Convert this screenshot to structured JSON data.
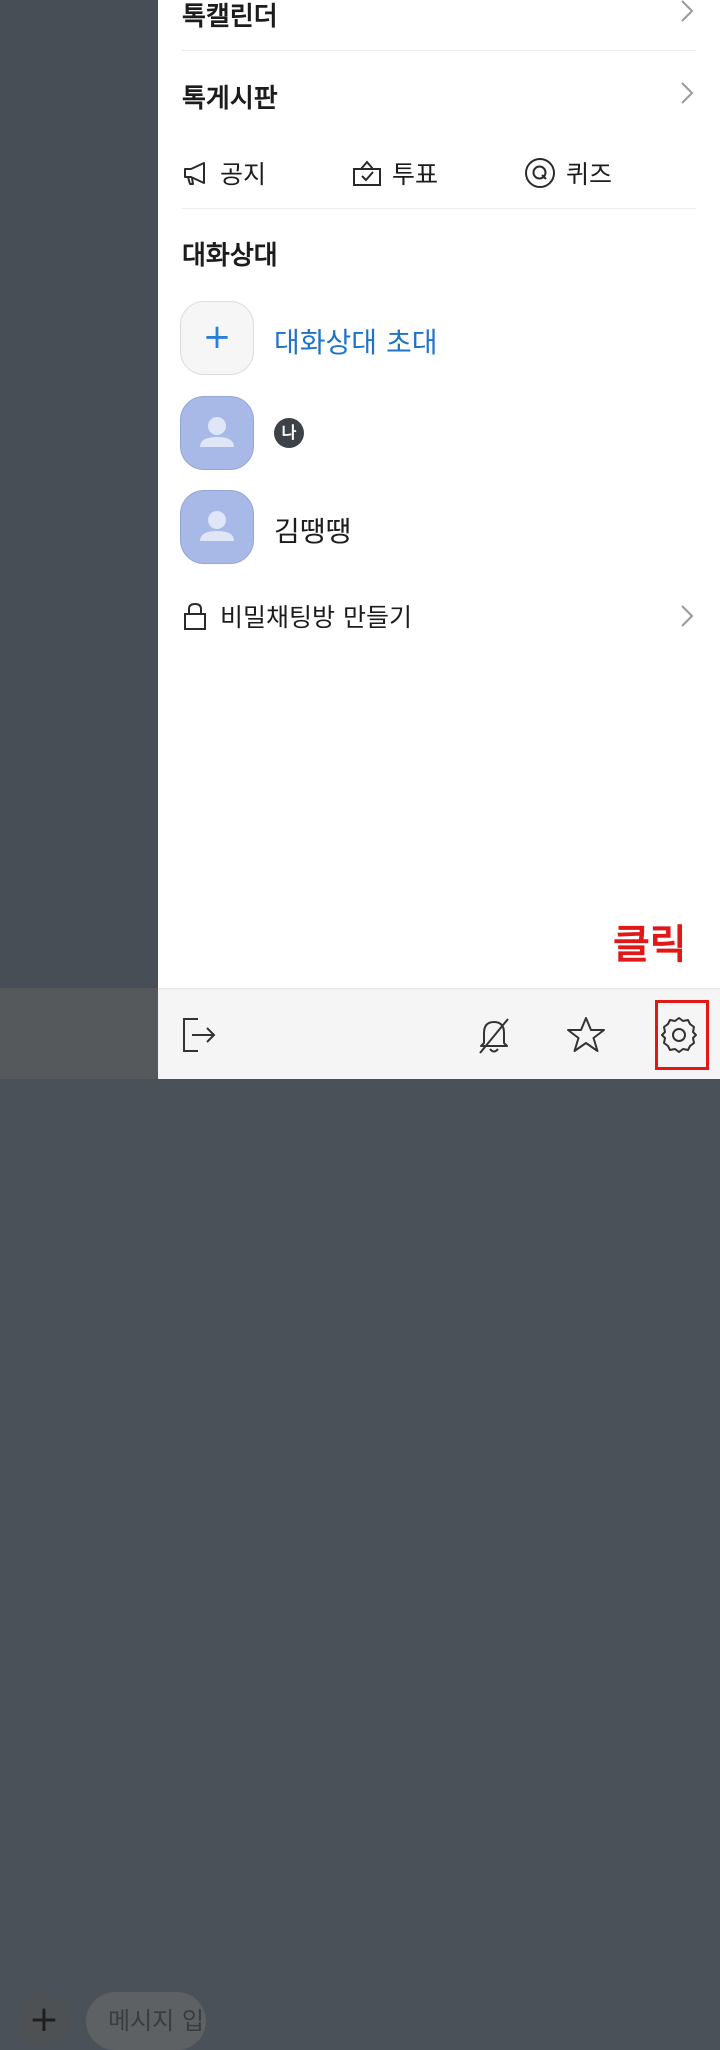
{
  "background": {
    "compose_placeholder": "메시지 입력"
  },
  "drawer": {
    "nav": [
      {
        "label": "톡캘린더"
      },
      {
        "label": "톡게시판"
      }
    ],
    "quick_actions": [
      {
        "label": "공지",
        "icon": "megaphone-icon"
      },
      {
        "label": "투표",
        "icon": "ballot-box-icon"
      },
      {
        "label": "퀴즈",
        "icon": "quiz-q-icon"
      }
    ],
    "members_section": {
      "title": "대화상대",
      "invite_label": "대화상대 초대",
      "members": [
        {
          "name": "",
          "me_badge": "나"
        },
        {
          "name": "김땡땡"
        }
      ]
    },
    "secret_chat_label": "비밀채팅방 만들기",
    "annotation": "클릭",
    "bottom_bar": {
      "buttons": [
        "exit-icon",
        "bell-off-icon",
        "star-icon",
        "settings-gear-icon"
      ]
    }
  },
  "colors": {
    "accent_blue": "#1f74c8",
    "annotation_red": "#e01818",
    "avatar_blue": "#a8b9e8"
  }
}
